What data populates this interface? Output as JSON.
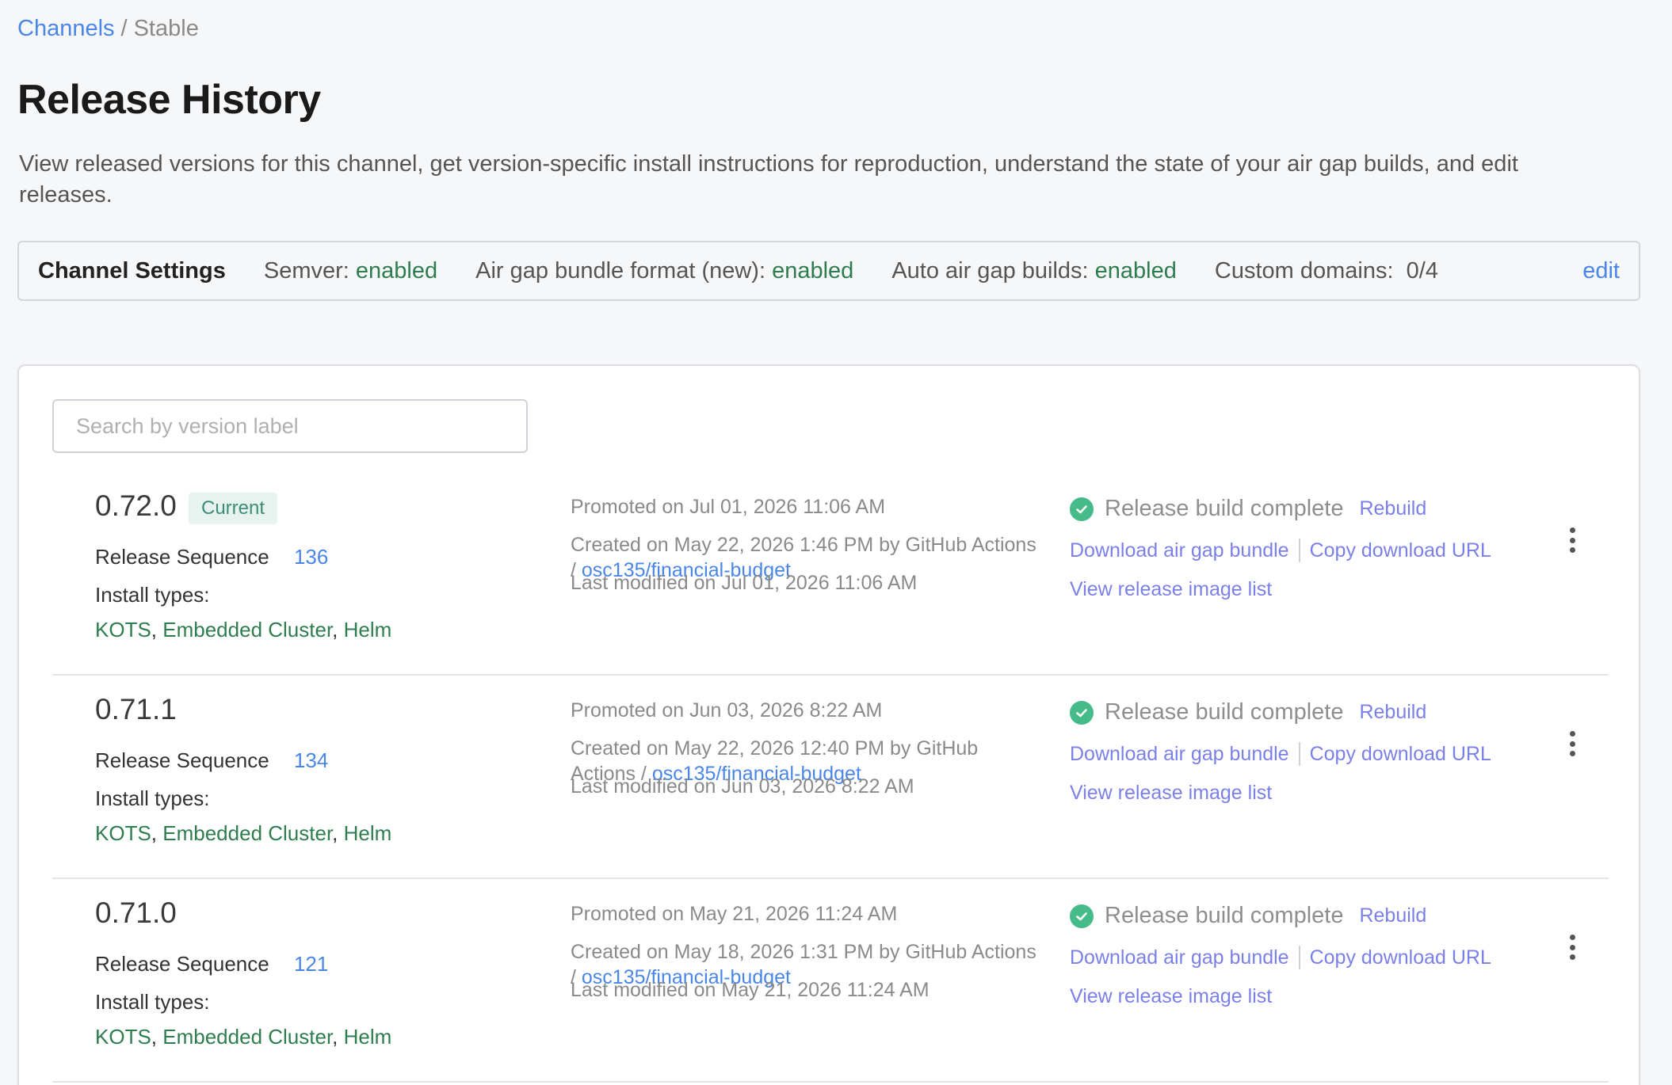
{
  "breadcrumb": {
    "parent": "Channels",
    "separator": "/",
    "current": "Stable"
  },
  "page": {
    "title": "Release History",
    "description": "View released versions for this channel, get version-specific install instructions for reproduction, understand the state of your air gap builds, and edit releases."
  },
  "channel_settings": {
    "title": "Channel Settings",
    "semver_label": "Semver:",
    "semver_value": "enabled",
    "airgap_format_label": "Air gap bundle format (new):",
    "airgap_format_value": "enabled",
    "auto_airgap_label": "Auto air gap builds:",
    "auto_airgap_value": "enabled",
    "custom_domains_label": "Custom domains:",
    "custom_domains_value": "0/4",
    "edit_label": "edit"
  },
  "search": {
    "placeholder": "Search by version label",
    "value": ""
  },
  "labels": {
    "release_sequence": "Release Sequence",
    "install_types": "Install types:",
    "build_complete": "Release build complete",
    "rebuild": "Rebuild",
    "download_bundle": "Download air gap bundle",
    "copy_url": "Copy download URL",
    "view_image_list": "View release image list",
    "comma": ","
  },
  "releases": [
    {
      "version": "0.72.0",
      "badge": "Current",
      "sequence": "136",
      "install_types": [
        "KOTS",
        "Embedded Cluster",
        "Helm"
      ],
      "promoted": "Promoted on Jul 01, 2026 11:06 AM",
      "created_prefix": "Created on May 22, 2026 1:46 PM by GitHub Actions /",
      "created_link": "osc135/financial-budget",
      "modified": "Last modified on Jul 01, 2026 11:06 AM"
    },
    {
      "version": "0.71.1",
      "badge": "",
      "sequence": "134",
      "install_types": [
        "KOTS",
        "Embedded Cluster",
        "Helm"
      ],
      "promoted": "Promoted on Jun 03, 2026 8:22 AM",
      "created_prefix": "Created on May 22, 2026 12:40 PM by GitHub Actions /",
      "created_link": "osc135/financial-budget",
      "modified": "Last modified on Jun 03, 2026 8:22 AM"
    },
    {
      "version": "0.71.0",
      "badge": "",
      "sequence": "121",
      "install_types": [
        "KOTS",
        "Embedded Cluster",
        "Helm"
      ],
      "promoted": "Promoted on May 21, 2026 11:24 AM",
      "created_prefix": "Created on May 18, 2026 1:31 PM by GitHub Actions /",
      "created_link": "osc135/financial-budget",
      "modified": "Last modified on May 21, 2026 11:24 AM"
    }
  ],
  "colors": {
    "link_blue": "#4a86e8",
    "link_purple": "#7b7fe8",
    "enabled_green": "#2e7d4f",
    "check_green": "#44bb88",
    "badge_bg": "#e6f3ef",
    "badge_text": "#3e8c77"
  },
  "icons": {
    "status": "check-circle-icon",
    "menu": "kebab-menu-icon"
  }
}
